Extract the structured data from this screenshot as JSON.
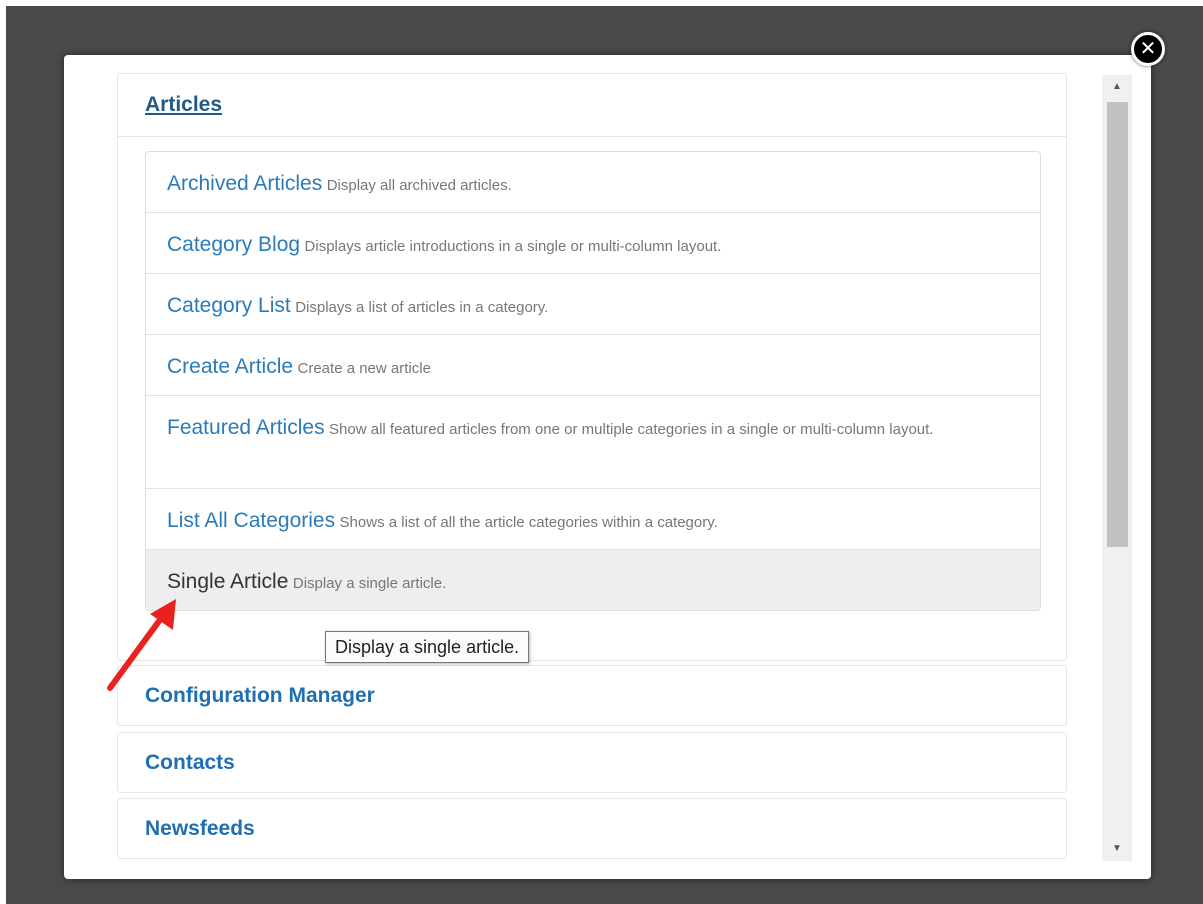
{
  "close_label": "✕",
  "accordion": [
    {
      "heading": "Articles",
      "items": [
        {
          "title": "Archived Articles",
          "desc": "Display all archived articles."
        },
        {
          "title": "Category Blog",
          "desc": "Displays article introductions in a single or multi-column layout."
        },
        {
          "title": "Category List",
          "desc": "Displays a list of articles in a category."
        },
        {
          "title": "Create Article",
          "desc": "Create a new article"
        },
        {
          "title": "Featured Articles",
          "desc": "Show all featured articles from one or multiple categories in a single or multi-column layout."
        },
        {
          "title": "List All Categories",
          "desc": "Shows a list of all the article categories within a category."
        },
        {
          "title": "Single Article",
          "desc": "Display a single article."
        }
      ]
    },
    {
      "heading": "Configuration Manager"
    },
    {
      "heading": "Contacts"
    },
    {
      "heading": "Newsfeeds"
    }
  ],
  "tooltip": "Display a single article.",
  "scrollbar": {
    "up_glyph": "▲",
    "down_glyph": "▼"
  },
  "colors": {
    "link": "#2b7bb9",
    "heading": "#1f6fb2",
    "highlight_bg": "#eeeeee",
    "annotation_arrow": "#e8231f"
  }
}
